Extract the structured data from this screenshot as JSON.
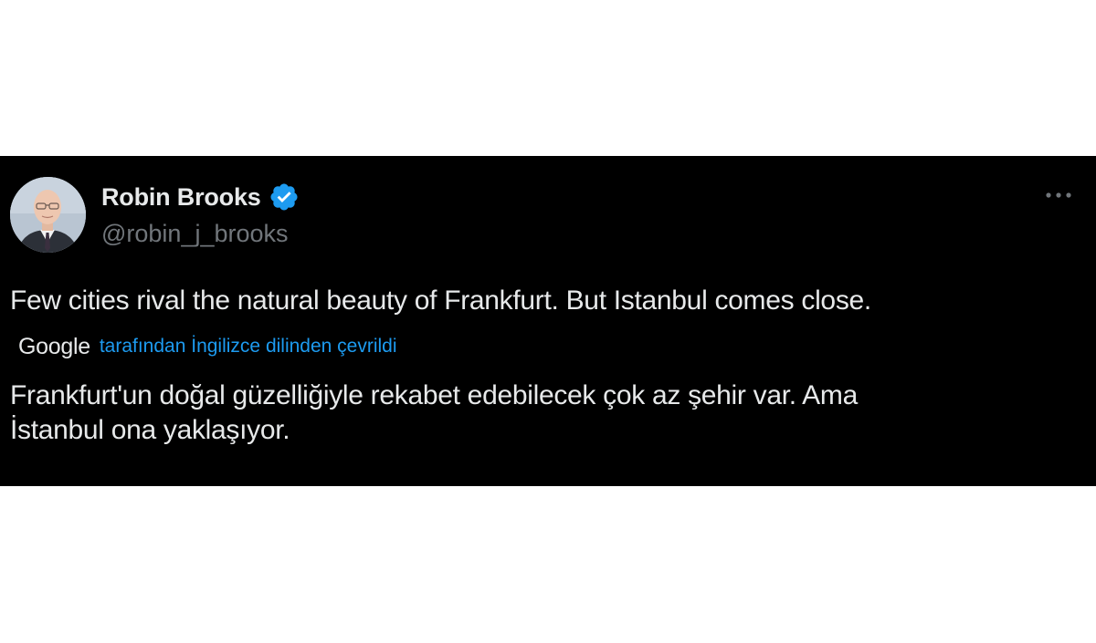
{
  "tweet": {
    "author": {
      "display_name": "Robin Brooks",
      "handle": "@robin_j_brooks",
      "verified": true
    },
    "text": "Few cities rival the natural beauty of Frankfurt. But Istanbul comes close.",
    "translation": {
      "provider": "Google",
      "label": "tarafından İngilizce dilinden çevrildi",
      "lines": [
        "Frankfurt'un doğal güzelliğiyle rekabet edebilecek çok az şehir var. Ama",
        "İstanbul ona yaklaşıyor."
      ]
    },
    "more_icon": "more-horizontal-icon"
  },
  "colors": {
    "background": "#000000",
    "primary_text": "#e7e9ea",
    "secondary_text": "#71767b",
    "accent": "#1d9bf0"
  }
}
